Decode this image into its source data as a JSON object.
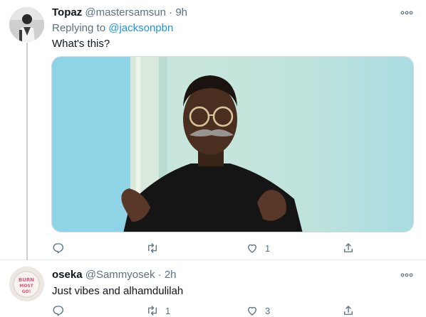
{
  "tweets": [
    {
      "name": "Topaz",
      "handle": "@mastersamsun",
      "separator": "·",
      "time": "9h",
      "replying_prefix": "Replying to",
      "replying_to": "@jacksonpbn",
      "text": "What's this?",
      "actions": {
        "reply_count": "",
        "retweet_count": "",
        "like_count": "1"
      }
    },
    {
      "name": "oseka",
      "handle": "@Sammyosek",
      "separator": "·",
      "time": "2h",
      "text": "Just vibes and alhamdulilah",
      "avatar_text": "BURN MOST GO!",
      "actions": {
        "reply_count": "",
        "retweet_count": "1",
        "like_count": "3"
      }
    }
  ],
  "icons": [
    "more-icon",
    "reply-icon",
    "retweet-icon",
    "like-icon",
    "share-icon"
  ],
  "colors": {
    "secondary_text": "#5b7083",
    "link": "#1b95e0",
    "divider": "#ebeef0",
    "thread_line": "#c4cfd6"
  }
}
